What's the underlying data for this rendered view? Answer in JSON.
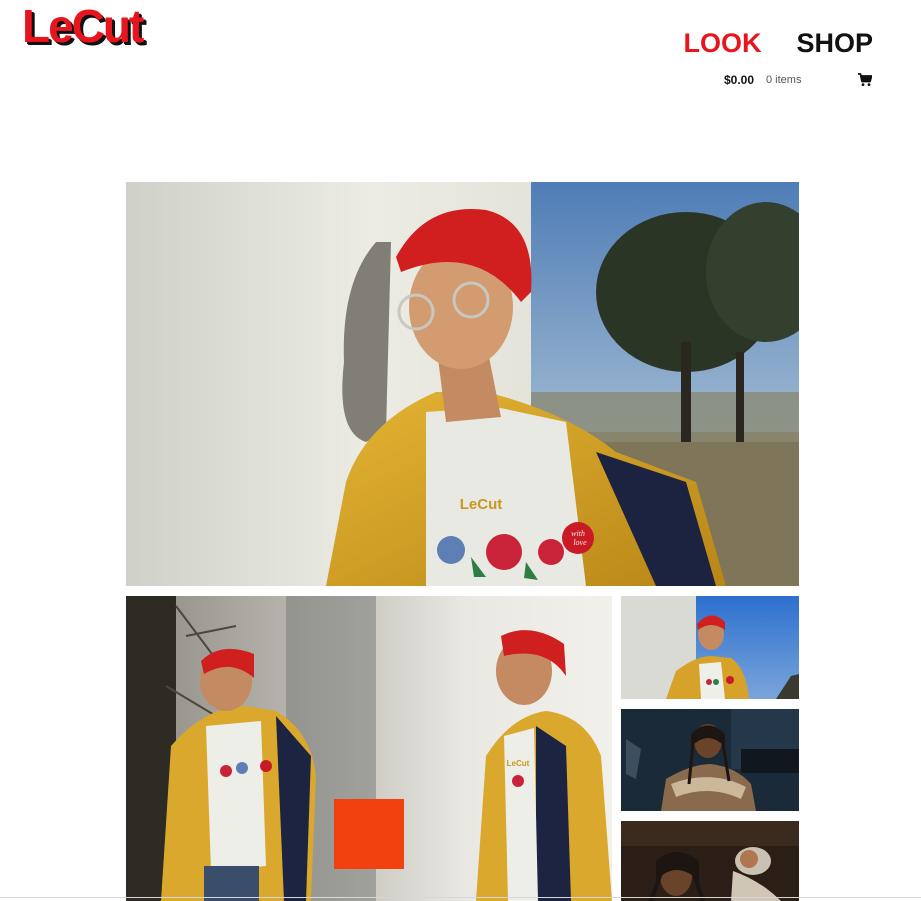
{
  "header": {
    "logo_text": "LeCut"
  },
  "nav": {
    "items": [
      {
        "label": "LOOK",
        "active": true
      },
      {
        "label": "SHOP",
        "active": false
      }
    ]
  },
  "cart": {
    "amount": "$0.00",
    "items": "0 items",
    "icon": "shopping-cart-icon"
  },
  "colors": {
    "brand_red": "#e8151f",
    "text_dark": "#111111",
    "accent_orange": "#f2400f"
  },
  "gallery": {
    "hero_shirt_text": "LeCut",
    "large_shirt_text": "LeCut",
    "badge_text_1": "with",
    "badge_text_2": "love"
  }
}
